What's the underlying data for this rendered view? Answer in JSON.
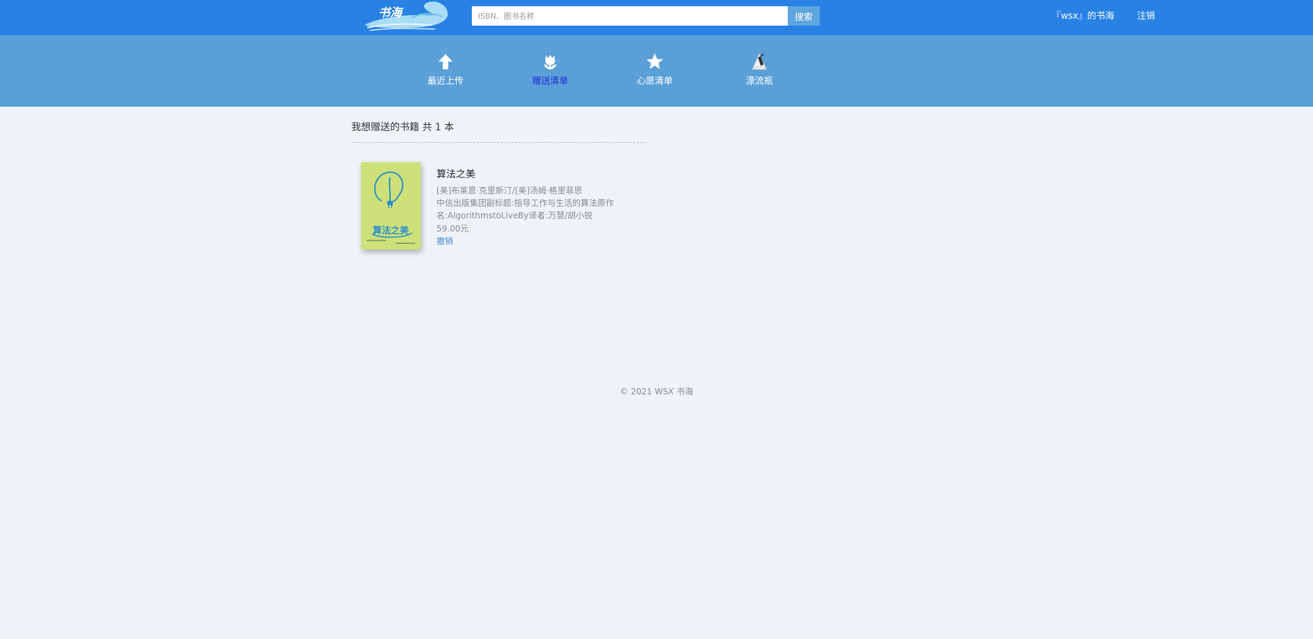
{
  "header": {
    "logo_text": "书海",
    "search_placeholder": "ISBN、图书名称",
    "search_button": "搜索",
    "user_label": "『wsx』的书海",
    "logout_label": "注销"
  },
  "nav": {
    "items": [
      {
        "label": "最近上传",
        "icon": "upload-arrow-icon",
        "active": false
      },
      {
        "label": "赠送清单",
        "icon": "tulip-flower-icon",
        "active": true
      },
      {
        "label": "心愿清单",
        "icon": "star-icon",
        "active": false
      },
      {
        "label": "漂流瓶",
        "icon": "drift-bottle-icon",
        "active": false
      }
    ]
  },
  "main": {
    "section_title": "我想赠送的书籍 共 1 本",
    "books": [
      {
        "cover_title": "算法之美",
        "title": "算法之美",
        "author": "[美]布莱恩·克里斯汀/[美]汤姆·格里菲思",
        "publisher": "中信出版集团副标题:指导工作与生活的算法原作名:AlgorithmstoLiveBy译者:万慧/胡小锐",
        "price": "59.00元",
        "action": "撤销"
      }
    ]
  },
  "footer": {
    "copyright": "© 2021 WSX 书海"
  },
  "colors": {
    "topbar": "#2981e4",
    "navband": "#5b9fd7",
    "active_nav": "#1a2fd8",
    "background": "#eff3f7",
    "cover": "#cde07a"
  }
}
